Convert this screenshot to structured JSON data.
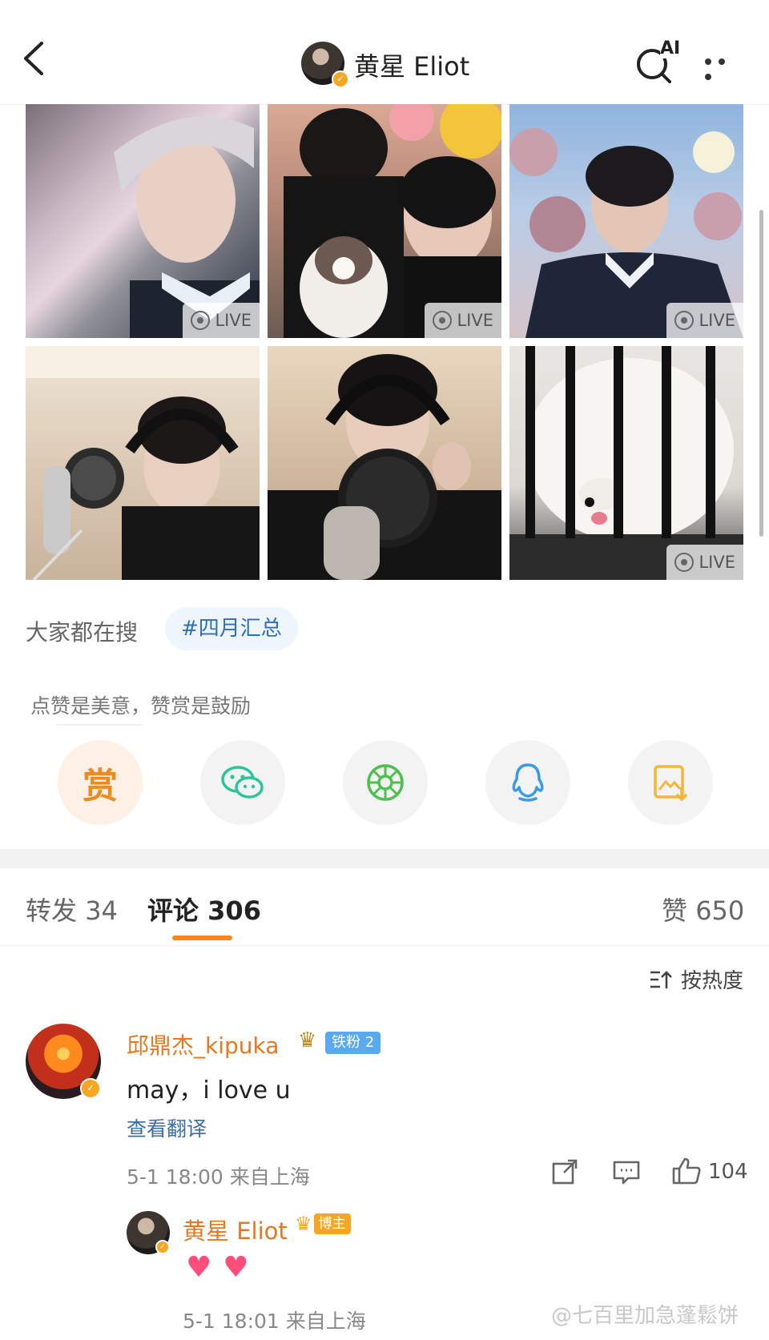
{
  "header": {
    "title": "黄星 Eliot",
    "ai_label": "AI"
  },
  "photos": [
    {
      "live": "LIVE"
    },
    {
      "live": "LIVE"
    },
    {
      "live": "LIVE"
    },
    {
      "live": ""
    },
    {
      "live": ""
    },
    {
      "live": "LIVE"
    }
  ],
  "hot_search": {
    "label": "大家都在搜",
    "tag": "#四月汇总"
  },
  "reward": {
    "text": "点赞是美意，赞赏是鼓励",
    "reward_label": "赏"
  },
  "tabs": [
    {
      "label": "转发",
      "count": "34"
    },
    {
      "label": "评论",
      "count": "306"
    },
    {
      "label": "赞",
      "count": "650"
    }
  ],
  "sort_label": "按热度",
  "comment": {
    "name": "邱鼎杰_kipuka",
    "fan_badge": "铁粉 2",
    "text": "may，i love u",
    "translate": "查看翻译",
    "meta": "5-1 18:00 来自上海",
    "likes": "104"
  },
  "reply": {
    "name": "黄星 Eliot",
    "badge": "博主",
    "meta": "5-1 18:01 来自上海"
  },
  "watermark": "@七百里加急蓬鬆饼",
  "colors": {
    "accent": "#f08a1c",
    "name": "#e8781f",
    "link": "#3a6ea5",
    "wechat": "#2cc59b",
    "moments": "#4fbf4f",
    "qq": "#3a9ae8",
    "save": "#f5b43a"
  }
}
